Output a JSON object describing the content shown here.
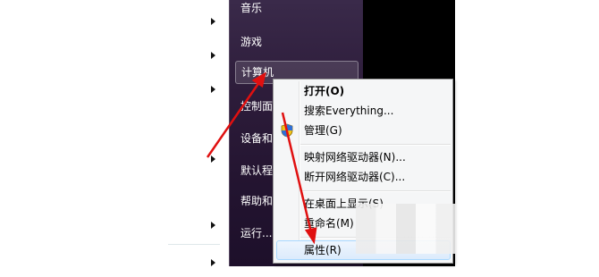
{
  "start_menu": {
    "items": [
      {
        "label": "音乐"
      },
      {
        "label": "游戏"
      },
      {
        "label": "计算机"
      },
      {
        "label": "控制面"
      },
      {
        "label": "设备和"
      },
      {
        "label": "默认程"
      },
      {
        "label": "帮助和"
      },
      {
        "label": "运行..."
      }
    ]
  },
  "context_menu": {
    "items": [
      {
        "label": "打开(O)",
        "bold": true
      },
      {
        "label": "搜索Everything..."
      },
      {
        "label": "管理(G)",
        "icon": "uac-shield-icon"
      },
      {
        "label": "映射网络驱动器(N)..."
      },
      {
        "label": "断开网络驱动器(C)..."
      },
      {
        "label": "在桌面上显示(S)"
      },
      {
        "label": "重命名(M)"
      },
      {
        "label": "属性(R)",
        "highlighted": true
      }
    ]
  },
  "annotation_color": "#e01010"
}
